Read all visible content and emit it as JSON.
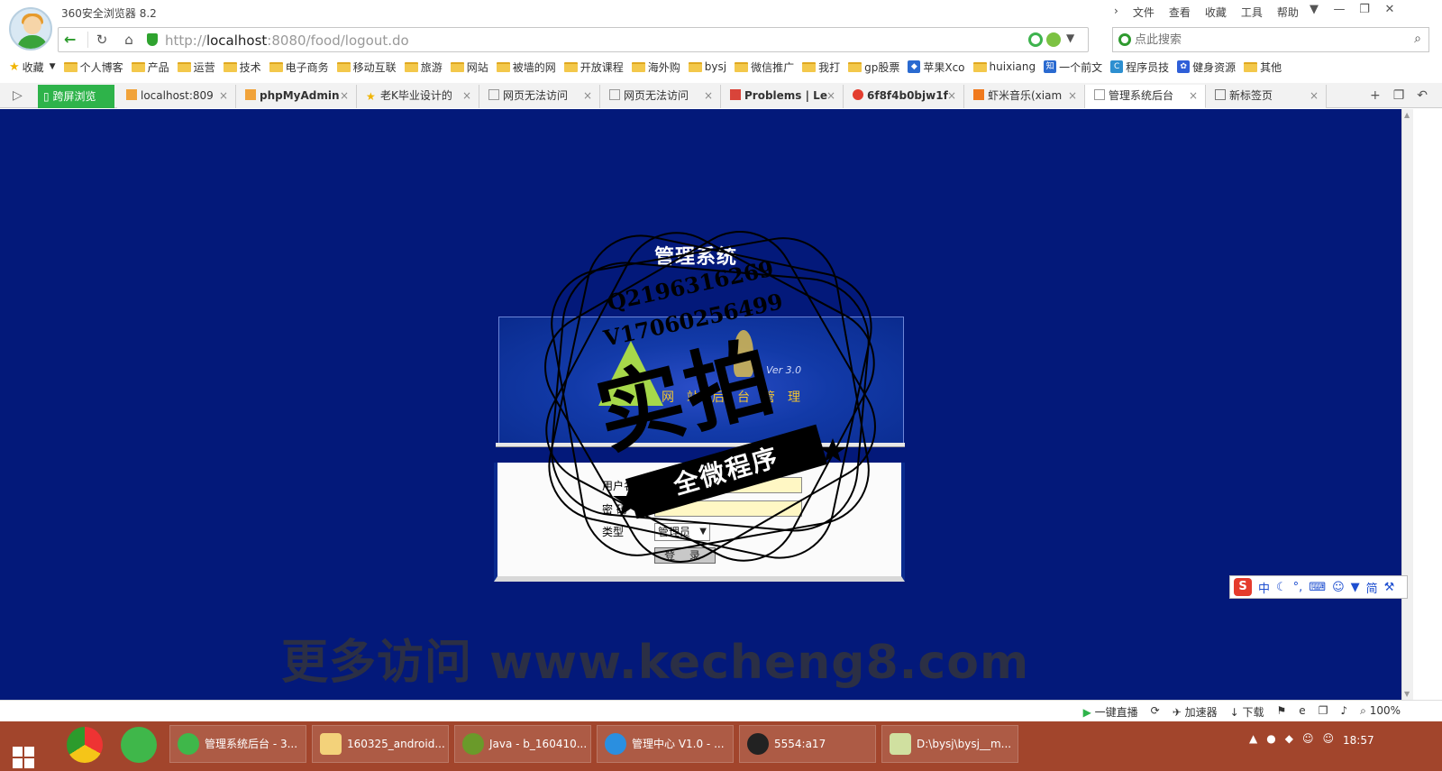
{
  "window": {
    "app_title": "360安全浏览器 8.2",
    "menu": [
      "文件",
      "查看",
      "收藏",
      "工具",
      "帮助"
    ]
  },
  "address_bar": {
    "url_scheme": "http://",
    "url_host": "localhost",
    "url_rest": ":8080/food/logout.do"
  },
  "search": {
    "placeholder": "点此搜索"
  },
  "bookmarks": {
    "favorites_label": "收藏",
    "items": [
      "个人博客",
      "产品",
      "运营",
      "技术",
      "电子商务",
      "移动互联",
      "旅游",
      "网站",
      "被墙的网",
      "开放课程",
      "海外购",
      "bysj",
      "微信推广",
      "我打",
      "gp股票",
      "苹果Xco",
      "huixiang",
      "一个前文",
      "程序员技",
      "健身资源",
      "其他"
    ]
  },
  "tabs": {
    "special": "跨屏浏览",
    "items": [
      "localhost:809",
      "phpMyAdmin",
      "老K毕业设计的",
      "网页无法访问",
      "网页无法访问",
      "Problems | Le",
      "6f8f4b0bjw1f",
      "虾米音乐(xiam",
      "管理系统后台",
      "新标签页"
    ],
    "active_index": 8
  },
  "login_page": {
    "title": "管理系统",
    "banner_version": "Ver 3.0",
    "banner_subtitle": "网站后台管理",
    "username_label": "用户名",
    "password_label": "密 码",
    "type_label": "类型",
    "type_selected": "管理员",
    "login_button": "登 录"
  },
  "overlay": {
    "qq": "Q2196316269",
    "wx": "V17060256499",
    "big": "实拍",
    "ribbon": "全微程序",
    "watermark": "更多访问 www.kecheng8.com"
  },
  "ime": {
    "labels": [
      "中",
      "简"
    ]
  },
  "status_bar": {
    "items": [
      "一键直播",
      "加速器",
      "下载",
      "100%"
    ]
  },
  "taskbar": {
    "items": [
      "管理系统后台 - 3...",
      "160325_android...",
      "Java - b_160410...",
      "管理中心 V1.0 - ...",
      "5554:a17",
      "D:\\bysj\\bysj__m..."
    ],
    "clock": "18:57"
  },
  "colors": {
    "page_background": "#03197a",
    "accent_green": "#2eb34a",
    "taskbar": "#a2452c"
  }
}
